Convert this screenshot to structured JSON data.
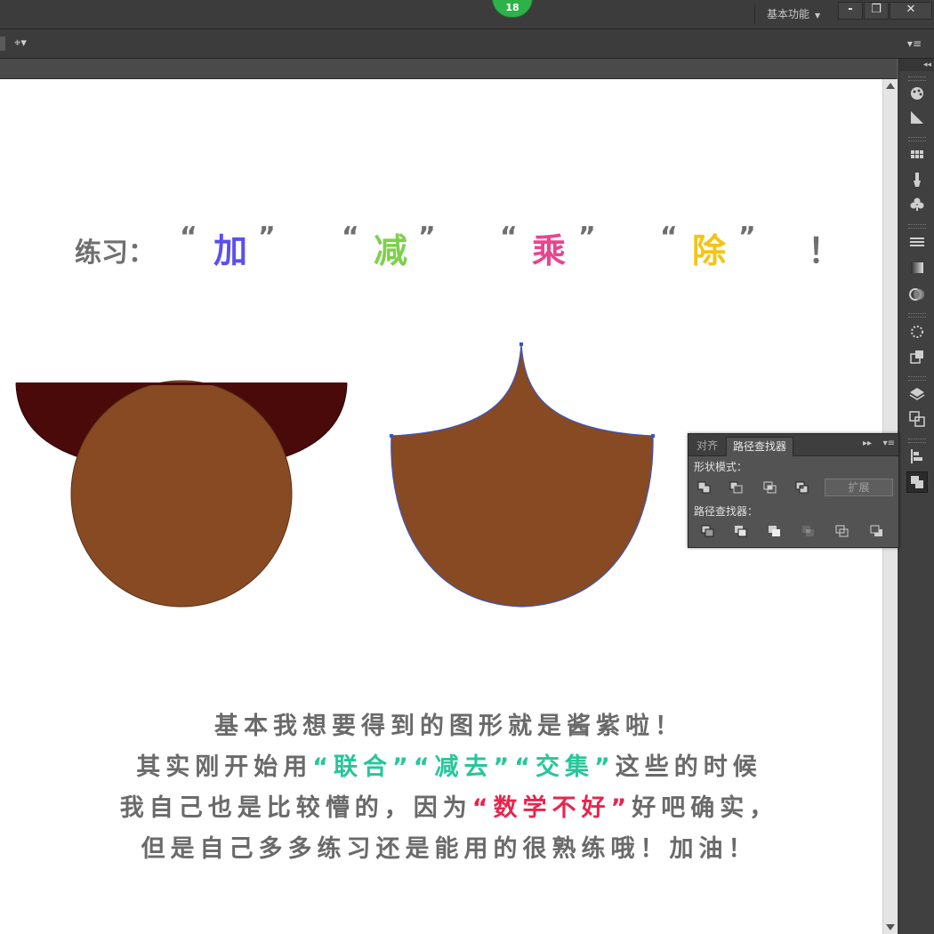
{
  "titlebar": {
    "badge": "18",
    "workspace": "基本功能",
    "minimize": "-",
    "restore": "❐",
    "close": "✕"
  },
  "toolbar": {
    "icon": "⌖▾",
    "panel_menu": "▾≡"
  },
  "dock": {
    "collapse": "◂◂",
    "icons": [
      "color-guide-icon",
      "gradient-icon",
      "swatch-grid-icon",
      "brush-icon",
      "symbol-icon",
      "stroke-icon",
      "transparency-icon",
      "appearance-icon",
      "graphic-style-icon",
      "export-icon",
      "layers-icon",
      "artboards-icon",
      "align-icon",
      "pathfinder-icon"
    ]
  },
  "canvas": {
    "heading": {
      "prefix": "练习：",
      "open_quote": "“",
      "close_quote": "”",
      "words": [
        "加",
        "减",
        "乘",
        "除"
      ],
      "word_colors": [
        "#5b4ff0",
        "#7ed04c",
        "#e8458f",
        "#f3c414"
      ],
      "exclaim": "！"
    },
    "paragraph": [
      "基本我想要得到的图形就是酱紫啦！",
      {
        "pre": "其实刚开始用",
        "q1": "“联合”",
        "mid1": "",
        "q2": "“减去”",
        "mid2": "",
        "q3": "“交集”",
        "post": "这些的时候"
      },
      {
        "pre": "我自己也是比较懵的，因为",
        "hl": "“数学不好”",
        "post": "好吧确实，"
      },
      "但是自己多多练习还是能用的很熟练哦！加油！"
    ],
    "shape_colors": {
      "face": "#874a22",
      "hair": "#4a0a0a",
      "stroke": "#5d3318",
      "selection": "#3a56c4"
    }
  },
  "pathfinder_panel": {
    "tabs": [
      "对齐",
      "路径查找器"
    ],
    "tab_controls": "▸▸",
    "menu": "▾≡",
    "shape_modes_label": "形状模式：",
    "expand_button": "扩展",
    "pathfinders_label": "路径查找器："
  }
}
